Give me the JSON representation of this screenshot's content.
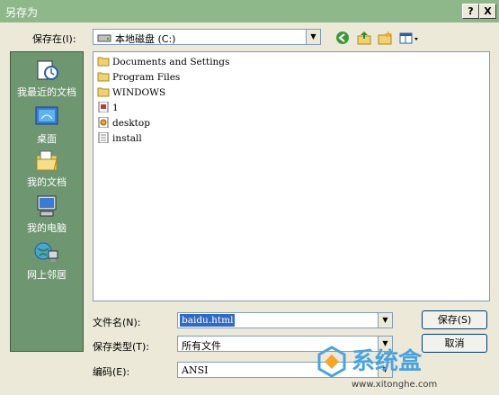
{
  "window": {
    "title": "另存为",
    "help_button": "?",
    "close_button": "X"
  },
  "toolbar": {
    "save_in_label": "保存在(I):",
    "save_in_value": "本地磁盘 (C:)",
    "buttons": [
      "back-icon",
      "up-folder-icon",
      "new-folder-icon",
      "views-menu-icon"
    ]
  },
  "places": [
    {
      "label": "我最近的文档",
      "icon": "recent-docs-icon"
    },
    {
      "label": "桌面",
      "icon": "desktop-icon"
    },
    {
      "label": "我的文档",
      "icon": "my-documents-icon"
    },
    {
      "label": "我的电脑",
      "icon": "my-computer-icon"
    },
    {
      "label": "网上邻居",
      "icon": "network-icon"
    }
  ],
  "files": [
    {
      "name": "Documents and Settings",
      "icon": "folder-icon"
    },
    {
      "name": "Program Files",
      "icon": "folder-icon"
    },
    {
      "name": "WINDOWS",
      "icon": "folder-icon"
    },
    {
      "name": "1",
      "icon": "file-icon"
    },
    {
      "name": "desktop",
      "icon": "settings-file-icon"
    },
    {
      "name": "install",
      "icon": "text-file-icon"
    }
  ],
  "form": {
    "filename_label": "文件名(N):",
    "filename_value": "baidu.html",
    "filetype_label": "保存类型(T):",
    "filetype_value": "所有文件",
    "encoding_label": "编码(E):",
    "encoding_value": "ANSI"
  },
  "buttons": {
    "save": "保存(S)",
    "cancel": "取消"
  },
  "watermark": {
    "brand": "系统盒",
    "url": "www.xitonghe.com"
  },
  "colors": {
    "titlebar": "#8FB88A",
    "places_bg": "#6E9670",
    "dialog_bg": "#ECE9D8"
  }
}
